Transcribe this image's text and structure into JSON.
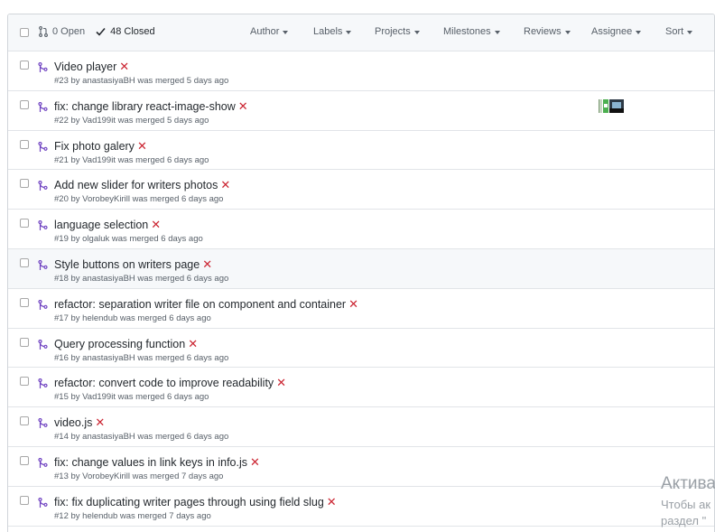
{
  "header": {
    "open_label": "0 Open",
    "closed_label": "48 Closed",
    "filters": [
      {
        "label": "Author",
        "name": "filter-author"
      },
      {
        "label": "Labels",
        "name": "filter-labels"
      },
      {
        "label": "Projects",
        "name": "filter-projects"
      },
      {
        "label": "Milestones",
        "name": "filter-milestones"
      },
      {
        "label": "Reviews",
        "name": "filter-reviews"
      },
      {
        "label": "Assignee",
        "name": "filter-assignee"
      },
      {
        "label": "Sort",
        "name": "filter-sort"
      }
    ]
  },
  "pull_requests": [
    {
      "title": "Video player",
      "meta": "#23 by anastasiyaBH was merged 5 days ago"
    },
    {
      "title": "fix: change library react-image-show",
      "meta": "#22 by Vad199it was merged 5 days ago",
      "has_avatars": true
    },
    {
      "title": "Fix photo galery",
      "meta": "#21 by Vad199it was merged 6 days ago"
    },
    {
      "title": "Add new slider for writers photos",
      "meta": "#20 by VorobeyKirill was merged 6 days ago"
    },
    {
      "title": "language selection",
      "meta": "#19 by olgaluk was merged 6 days ago"
    },
    {
      "title": "Style buttons on writers page",
      "meta": "#18 by anastasiyaBH was merged 6 days ago",
      "hover": true
    },
    {
      "title": "refactor: separation writer file on component and container",
      "meta": "#17 by helendub was merged 6 days ago"
    },
    {
      "title": "Query processing function",
      "meta": "#16 by anastasiyaBH was merged 6 days ago"
    },
    {
      "title": "refactor: convert code to improve readability",
      "meta": "#15 by Vad199it was merged 6 days ago"
    },
    {
      "title": "video.js",
      "meta": "#14 by anastasiyaBH was merged 6 days ago"
    },
    {
      "title": "fix: change values in link keys in info.js",
      "meta": "#13 by VorobeyKirill was merged 7 days ago"
    },
    {
      "title": "fix: fix duplicating writer pages through using field slug",
      "meta": "#12 by helendub was merged 7 days ago"
    }
  ],
  "status_mark": "✕",
  "colors": {
    "merged_icon": "#6f42c1",
    "failed_status": "#cb2431",
    "header_bg": "#f6f8fa",
    "border": "#e1e4e8"
  },
  "watermark": {
    "title": "Актива",
    "line1": "Чтобы ак",
    "line2": "раздел \""
  }
}
